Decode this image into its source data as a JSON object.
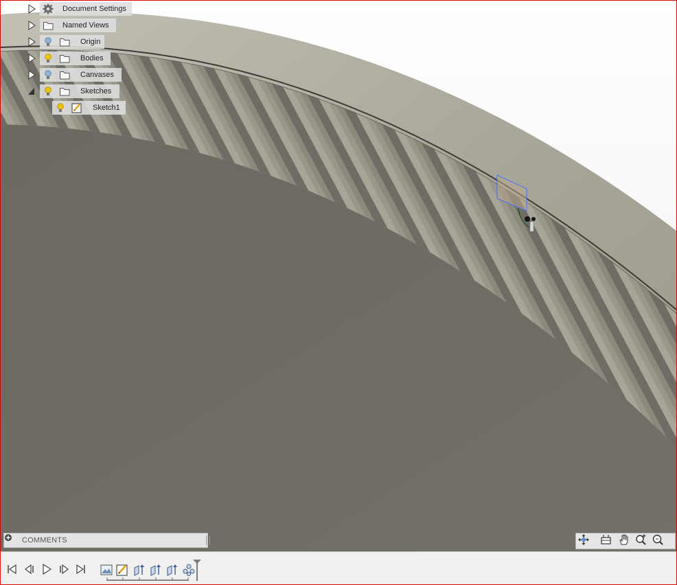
{
  "browser_tree": {
    "items": [
      {
        "label": "Document Settings",
        "icon": "gear-icon",
        "expanded": false
      },
      {
        "label": "Named Views",
        "icon": "folder-icon",
        "expanded": false
      },
      {
        "label": "Origin",
        "icon": "folder-icon",
        "visibility": "lightbulb-off-icon",
        "expanded": false
      },
      {
        "label": "Bodies",
        "icon": "folder-icon",
        "visibility": "lightbulb-on-icon",
        "expanded": false
      },
      {
        "label": "Canvases",
        "icon": "folder-icon",
        "visibility": "lightbulb-off-icon",
        "expanded": false
      },
      {
        "label": "Sketches",
        "icon": "folder-icon",
        "visibility": "lightbulb-on-icon",
        "expanded": true
      },
      {
        "label": "Sketch1",
        "icon": "sketch-icon",
        "visibility": "lightbulb-on-icon"
      }
    ]
  },
  "comments": {
    "label": "COMMENTS"
  },
  "nav_toolbar": {
    "buttons": [
      "orbit-icon",
      "look-at-icon",
      "pan-icon",
      "zoom-icon",
      "zoom-window-icon"
    ]
  },
  "timeline": {
    "playback": [
      "go-to-start-icon",
      "step-back-icon",
      "play-icon",
      "step-forward-icon",
      "go-to-end-icon"
    ],
    "features": [
      "canvas-feature-icon",
      "sketch-feature-icon",
      "extrude-feature-icon",
      "extrude-feature-icon",
      "extrude-feature-icon",
      "pattern-feature-icon"
    ]
  },
  "colors": {
    "frame_border": "#d40000",
    "part_face": "#6e6b63",
    "rim_face": "#a4a195",
    "selection_blue": "#5577ee",
    "lightbulb_on": "#f2c300",
    "lightbulb_off": "#8fb2d6"
  }
}
